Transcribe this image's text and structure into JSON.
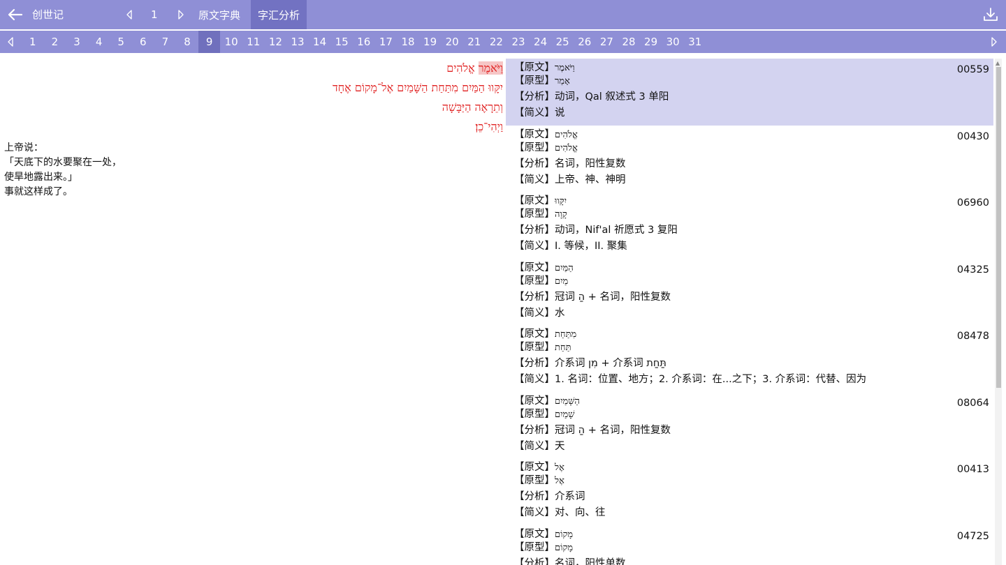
{
  "header": {
    "back_icon": "arrow-left-icon",
    "book_title": "创世记",
    "chapter": "1",
    "tabs": [
      {
        "label": "原文字典",
        "active": false
      },
      {
        "label": "字汇分析",
        "active": true
      }
    ],
    "download_icon": "download-icon"
  },
  "verse_bar": {
    "verses": [
      "1",
      "2",
      "3",
      "4",
      "5",
      "6",
      "7",
      "8",
      "9",
      "10",
      "11",
      "12",
      "13",
      "14",
      "15",
      "16",
      "17",
      "18",
      "19",
      "20",
      "21",
      "22",
      "23",
      "24",
      "25",
      "26",
      "27",
      "28",
      "29",
      "30",
      "31"
    ],
    "active": "9"
  },
  "text_pane": {
    "hebrew_lines": [
      {
        "highlight": "וַיֹּאמֶר",
        "rest": " אֱלֹהִים"
      },
      {
        "highlight": "",
        "rest": "יִקָּווּ הַמַּיִם מִתַּחַת הַשָּׁמַיִם אֶל־מָקוֹם אֶחָד"
      },
      {
        "highlight": "",
        "rest": "וְתֵרָאֶה הַיַּבָּשָׁה"
      },
      {
        "highlight": "",
        "rest": "וַיְהִי־כֵן׃"
      }
    ],
    "chinese_lines": [
      "上帝说：",
      "「天底下的水要聚在一处，",
      "使旱地露出来。」",
      "事就这样成了。"
    ]
  },
  "analysis": {
    "labels": {
      "original": "【原文】",
      "lemma": "【原型】",
      "parse": "【分析】",
      "gloss": "【简义】"
    },
    "entries": [
      {
        "original": "וַיֹּאמֶר",
        "lemma": "אָמַר",
        "parse": "动词，Qal 叙述式 3 单阳",
        "gloss": "说",
        "number": "00559",
        "selected": true
      },
      {
        "original": "אֱלֹהִים",
        "lemma": "אֱלֹהִים",
        "parse": "名词，阳性复数",
        "gloss": "上帝、神、神明",
        "number": "00430",
        "selected": false
      },
      {
        "original": "יִקָּווּ",
        "lemma": "קָוָה",
        "parse": "动词，Nif'al 祈愿式  3 复阳",
        "gloss": "I. 等候，II. 聚集",
        "number": "06960",
        "selected": false
      },
      {
        "original": "הַמַּיִם",
        "lemma": "מַיִם",
        "parse": "冠词 הַ + 名词，阳性复数",
        "gloss": "水",
        "number": "04325",
        "selected": false
      },
      {
        "original": "מִתַּחַת",
        "lemma": "תַּחַת",
        "parse": "介系词 מִן + 介系词 תַּחַת",
        "gloss": "1. 名词：位置、地方；2. 介系词：在...之下；3. 介系词：代替、因为",
        "number": "08478",
        "selected": false
      },
      {
        "original": "הַשָּׁמַיִם",
        "lemma": "שָׁמַיִם",
        "parse": "冠词 הַ + 名词，阳性复数",
        "gloss": "天",
        "number": "08064",
        "selected": false
      },
      {
        "original": "אֶל",
        "lemma": "אֶל",
        "parse": "介系词",
        "gloss": "对、向、往",
        "number": "00413",
        "selected": false
      },
      {
        "original": "מָקוֹם",
        "lemma": "מָקוֹם",
        "parse": "名词，阳性单数",
        "gloss": "",
        "number": "04725",
        "selected": false
      }
    ]
  },
  "colors": {
    "accent": "#8f8fd6",
    "active_tab": "#7272c2",
    "selected_row": "#d3d3f0",
    "hebrew_text": "#e02020",
    "highlight": "#f6c6c6"
  }
}
